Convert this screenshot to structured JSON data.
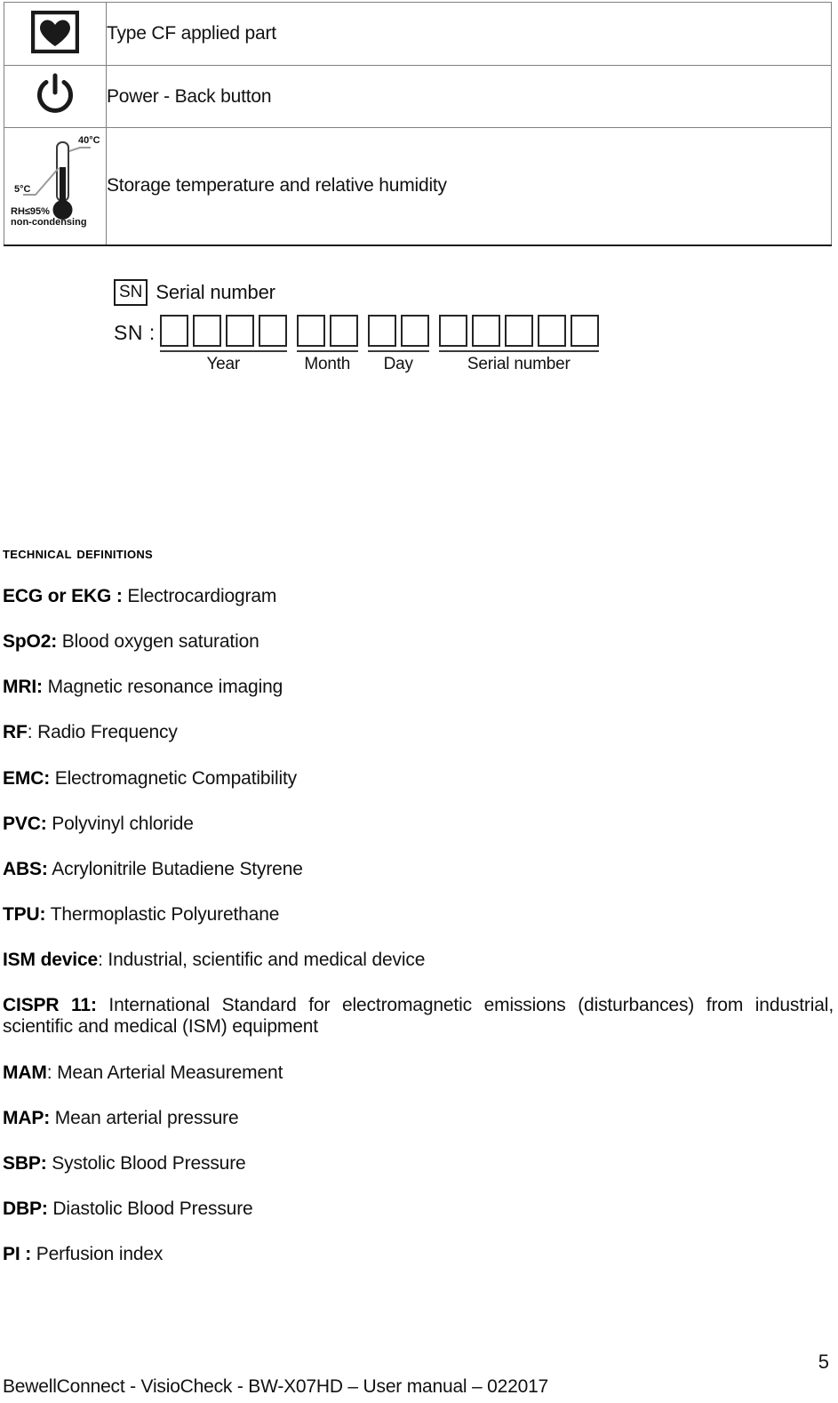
{
  "symbol_table": {
    "rows": [
      {
        "icon": "type-cf-applied-part-icon",
        "label": "Type CF applied part"
      },
      {
        "icon": "power-back-button-icon",
        "label": "Power - Back button"
      },
      {
        "icon": "storage-temperature-humidity-icon",
        "label": "Storage temperature and relative humidity"
      }
    ],
    "thermometer_icon": {
      "temp_high": "40°C",
      "temp_low": "5°C",
      "humidity_line1": "RH≤95%",
      "humidity_line2": "non-condensing"
    }
  },
  "serial_number": {
    "tag": "SN",
    "legend": "Serial number",
    "prefix": "SN :",
    "groups": [
      {
        "caption": "Year",
        "boxes": 4
      },
      {
        "caption": "Month",
        "boxes": 2
      },
      {
        "caption": "Day",
        "boxes": 2
      },
      {
        "caption": "Serial number",
        "boxes": 5
      }
    ]
  },
  "technical_definitions": {
    "heading": "Technical Definitions",
    "items": [
      {
        "term": "ECG or EKG :",
        "definition": "Electrocardiogram"
      },
      {
        "term": "SpO2:",
        "definition": "Blood oxygen saturation"
      },
      {
        "term": "MRI:",
        "definition": "Magnetic resonance imaging"
      },
      {
        "term": "RF",
        "definition": ": Radio Frequency"
      },
      {
        "term": "EMC:",
        "definition": "Electromagnetic Compatibility"
      },
      {
        "term": "PVC:",
        "definition": "Polyvinyl chloride"
      },
      {
        "term": "ABS:",
        "definition": "Acrylonitrile Butadiene Styrene"
      },
      {
        "term": "TPU:",
        "definition": "Thermoplastic Polyurethane"
      },
      {
        "term": "ISM device",
        "definition": ": Industrial, scientific and medical device"
      },
      {
        "term": "CISPR 11:",
        "definition": "International Standard for electromagnetic emissions (disturbances) from industrial, scientific and medical (ISM) equipment"
      },
      {
        "term": "MAM",
        "definition": ": Mean Arterial Measurement"
      },
      {
        "term": "MAP:",
        "definition": "Mean arterial pressure"
      },
      {
        "term": "SBP:",
        "definition": "Systolic Blood Pressure"
      },
      {
        "term": "DBP:",
        "definition": "Diastolic Blood Pressure"
      },
      {
        "term": "PI :",
        "definition": "Perfusion index"
      }
    ]
  },
  "footer": {
    "text": "BewellConnect - VisioCheck - BW-X07HD – User manual – 022017",
    "page_number": "5"
  }
}
